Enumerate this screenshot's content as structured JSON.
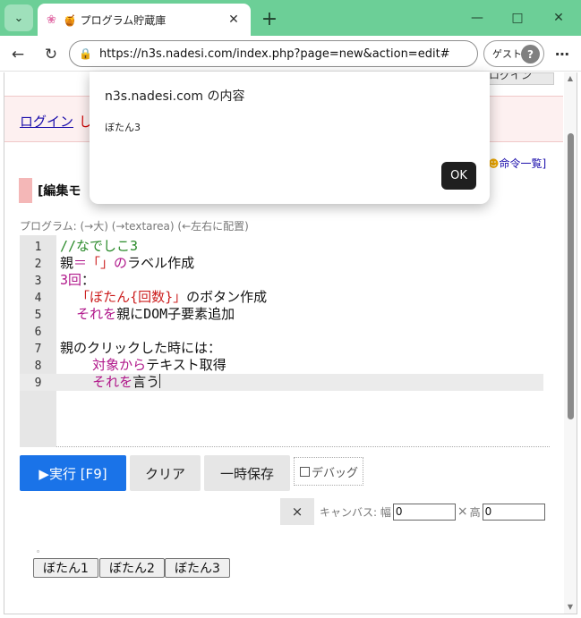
{
  "browser": {
    "tab_title": "🍯 プログラム貯蔵庫",
    "url": "https://n3s.nadesi.com/index.php?page=new&action=edit#",
    "profile_label": "ゲスト"
  },
  "page": {
    "login_button": "ログイン",
    "notice_link": "ログイン",
    "notice_rest": "し",
    "command_list": "命令一覧",
    "command_list_close": "]",
    "edit_mode_label": "[編集モ",
    "program_label": "プログラム: (→大) (→textarea) (←左右に配置)"
  },
  "editor": {
    "line_numbers": [
      "1",
      "2",
      "3",
      "4",
      "5",
      "6",
      "7",
      "8",
      "9"
    ],
    "lines": [
      [
        {
          "t": "//なでしこ3",
          "c": "comment"
        }
      ],
      [
        {
          "t": "親",
          "c": "plain"
        },
        {
          "t": "＝",
          "c": "kw"
        },
        {
          "t": "「」",
          "c": "str"
        },
        {
          "t": "の",
          "c": "kw"
        },
        {
          "t": "ラベル作成",
          "c": "plain"
        }
      ],
      [
        {
          "t": "3",
          "c": "kw"
        },
        {
          "t": "回",
          "c": "kw"
        },
        {
          "t": "：",
          "c": "plain"
        }
      ],
      [
        {
          "t": "  ",
          "c": "plain"
        },
        {
          "t": "「ぼたん{回数}」",
          "c": "str"
        },
        {
          "t": "のボタン作成",
          "c": "plain"
        }
      ],
      [
        {
          "t": "  ",
          "c": "plain"
        },
        {
          "t": "それを",
          "c": "kw"
        },
        {
          "t": "親にDOM子要素追加",
          "c": "plain"
        }
      ],
      [
        {
          "t": "",
          "c": "plain"
        }
      ],
      [
        {
          "t": "親のクリックした時には：",
          "c": "plain"
        }
      ],
      [
        {
          "t": "    ",
          "c": "plain"
        },
        {
          "t": "対象から",
          "c": "kw"
        },
        {
          "t": "テキスト取得",
          "c": "plain"
        }
      ],
      [
        {
          "t": "    ",
          "c": "plain"
        },
        {
          "t": "それを",
          "c": "kw"
        },
        {
          "t": "言う",
          "c": "plain"
        }
      ]
    ]
  },
  "buttons": {
    "run": "▶実行 [F9]",
    "clear": "クリア",
    "save": "一時保存",
    "debug": "デバッグ",
    "close_x": "×"
  },
  "canvas": {
    "label": "キャンバス: 幅",
    "width_value": "0",
    "times": "×",
    "height_label": "高",
    "height_value": "0"
  },
  "output": {
    "dot": "。",
    "buttons": [
      "ぼたん1",
      "ぼたん2",
      "ぼたん3"
    ]
  },
  "dialog": {
    "title": "n3s.nadesi.com の内容",
    "message": "ぼたん3",
    "ok": "OK"
  },
  "colors": {
    "tabstrip": "#6ccf97",
    "run_button": "#1a73e8",
    "keyword": "#b0178a",
    "string": "#cc1f1f",
    "comment": "#2a8a2a"
  }
}
